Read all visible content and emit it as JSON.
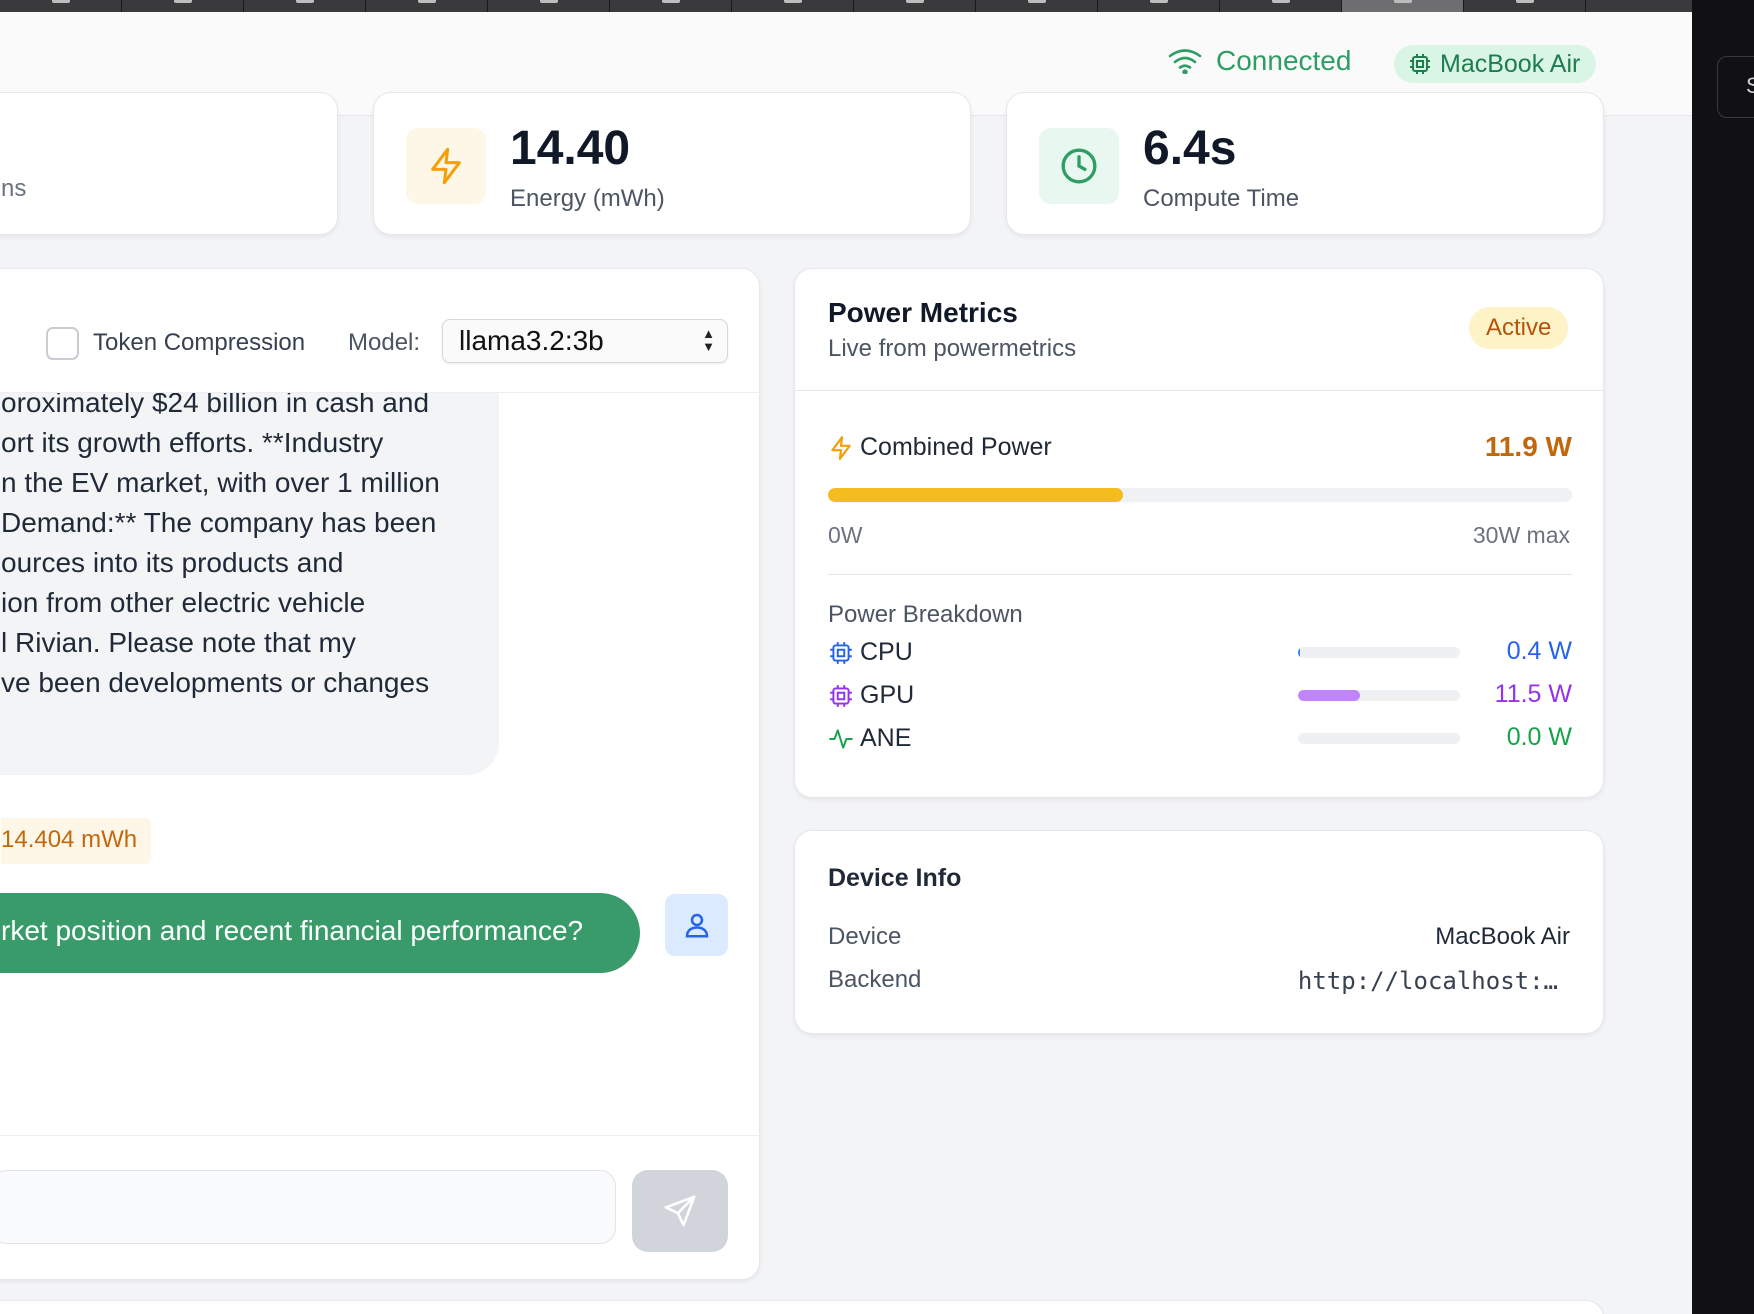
{
  "header": {
    "connection_status": "Connected",
    "device_badge": "MacBook Air"
  },
  "stats": {
    "partial_label": "ns",
    "energy": {
      "value": "14.40",
      "label": "Energy (mWh)"
    },
    "compute": {
      "value": "6.4s",
      "label": "Compute Time"
    }
  },
  "chat": {
    "token_compression_label": "Token Compression",
    "token_compression_checked": false,
    "model_label": "Model:",
    "model_value": "llama3.2:3b",
    "assistant_lines": [
      "oroximately $24 billion in cash and",
      "ort its growth efforts. **Industry",
      "n the EV market, with over 1 million",
      "Demand:** The company has been",
      "ources into its products and",
      "ion from other electric vehicle",
      "l Rivian. Please note that my",
      "ve been developments or changes"
    ],
    "energy_tag": "14.404 mWh",
    "user_message": "rket position and recent financial performance?",
    "input_placeholder": ""
  },
  "power_metrics": {
    "title": "Power Metrics",
    "subtitle": "Live from powermetrics",
    "status_badge": "Active",
    "combined": {
      "label": "Combined Power",
      "value": "11.9 W",
      "watts": 11.9,
      "max_watts": 30,
      "min_label": "0W",
      "max_label": "30W max"
    },
    "breakdown_title": "Power Breakdown",
    "breakdown": [
      {
        "name": "CPU",
        "value": "0.4 W",
        "watts": 0.4,
        "color": "#2563eb",
        "icon": "cpu-icon"
      },
      {
        "name": "GPU",
        "value": "11.5 W",
        "watts": 11.5,
        "color": "#9333ea",
        "icon": "cpu-icon"
      },
      {
        "name": "ANE",
        "value": "0.0 W",
        "watts": 0.0,
        "color": "#16a34a",
        "icon": "activity-icon"
      }
    ]
  },
  "device_info": {
    "title": "Device Info",
    "device_label": "Device",
    "device_value": "MacBook Air",
    "backend_label": "Backend",
    "backend_value": "http://localhost:…"
  },
  "colors": {
    "accent_green": "#2f9e64",
    "energy_orange": "#c2680c",
    "power_bar": "#f4bd1d",
    "gpu_bar": "#c084fc"
  }
}
